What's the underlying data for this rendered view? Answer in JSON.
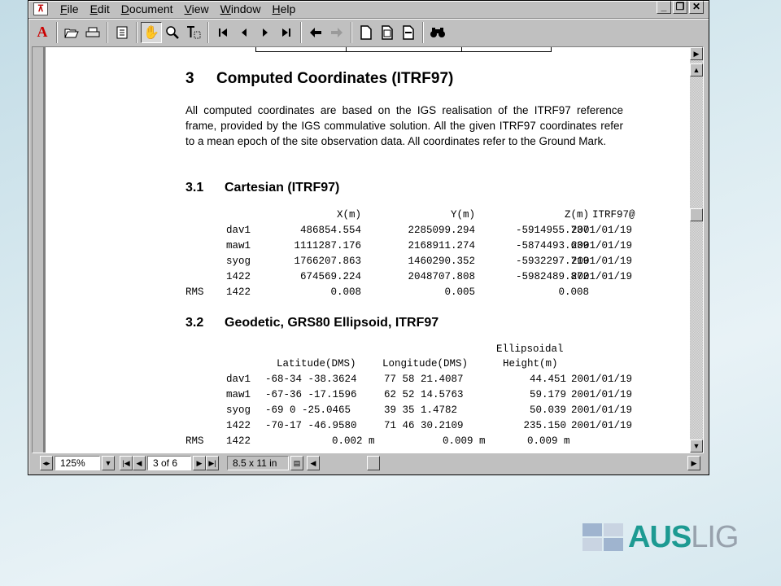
{
  "menu": {
    "items": [
      "File",
      "Edit",
      "Document",
      "View",
      "Window",
      "Help"
    ]
  },
  "window_controls": [
    "_",
    "❐",
    "✕"
  ],
  "toolbar": {
    "icons": [
      "acrobat-icon",
      "open-icon",
      "print-icon",
      "page-only-icon",
      "hand-tool-icon",
      "zoom-tool-icon",
      "text-select-icon",
      "first-page-icon",
      "prev-page-icon",
      "next-page-icon",
      "last-page-icon",
      "go-back-icon",
      "go-forward-icon",
      "actual-size-icon",
      "fit-page-icon",
      "fit-width-icon",
      "find-icon"
    ]
  },
  "document": {
    "section": {
      "num": "3",
      "title": "Computed Coordinates (ITRF97)"
    },
    "intro": "All computed coordinates are based on the IGS realisation of the ITRF97 reference frame, provided by the IGS commulative solution. All the given ITRF97 coordinates refer to a mean epoch of the site observation data.  All coordinates refer to the Ground Mark.",
    "cartesian": {
      "num": "3.1",
      "title": "Cartesian (ITRF97)",
      "headers": [
        "X(m)",
        "Y(m)",
        "Z(m)",
        "ITRF97@"
      ],
      "rows": [
        [
          "dav1",
          "486854.554",
          "2285099.294",
          "-5914955.737",
          "2001/01/19"
        ],
        [
          "maw1",
          "1111287.176",
          "2168911.274",
          "-5874493.639",
          "2001/01/19"
        ],
        [
          "syog",
          "1766207.863",
          "1460290.352",
          "-5932297.719",
          "2001/01/19"
        ],
        [
          "1422",
          "674569.224",
          "2048707.808",
          "-5982489.872",
          "2001/01/19"
        ]
      ],
      "rms": [
        "RMS",
        "1422",
        "0.008",
        "0.005",
        "0.008"
      ]
    },
    "geodetic": {
      "num": "3.2",
      "title": "Geodetic, GRS80 Ellipsoid, ITRF97",
      "header_top": "Ellipsoidal",
      "headers": [
        "Latitude(DMS)",
        "Longitude(DMS)",
        "Height(m)"
      ],
      "rows": [
        [
          "dav1",
          "-68-34 -38.3624",
          "77 58  21.4087",
          "44.451",
          "2001/01/19"
        ],
        [
          "maw1",
          "-67-36 -17.1596",
          "62 52  14.5763",
          "59.179",
          "2001/01/19"
        ],
        [
          "syog",
          "-69  0 -25.0465",
          "39 35   1.4782",
          "50.039",
          "2001/01/19"
        ],
        [
          "1422",
          "-70-17 -46.9580",
          "71 46  30.2109",
          "235.150",
          "2001/01/19"
        ]
      ],
      "rms": [
        "RMS",
        "1422",
        "0.002 m",
        "0.009 m",
        "0.009 m"
      ]
    }
  },
  "status": {
    "zoom": "125%",
    "page": "3 of 6",
    "page_size": "8.5 x 11 in"
  },
  "logo": {
    "part1": "AUS",
    "part2": "LIG"
  },
  "colors": {
    "logo_teal": "#1d9a92",
    "logo_grey": "#98a2ad",
    "window_grey": "#c0c0c0"
  }
}
